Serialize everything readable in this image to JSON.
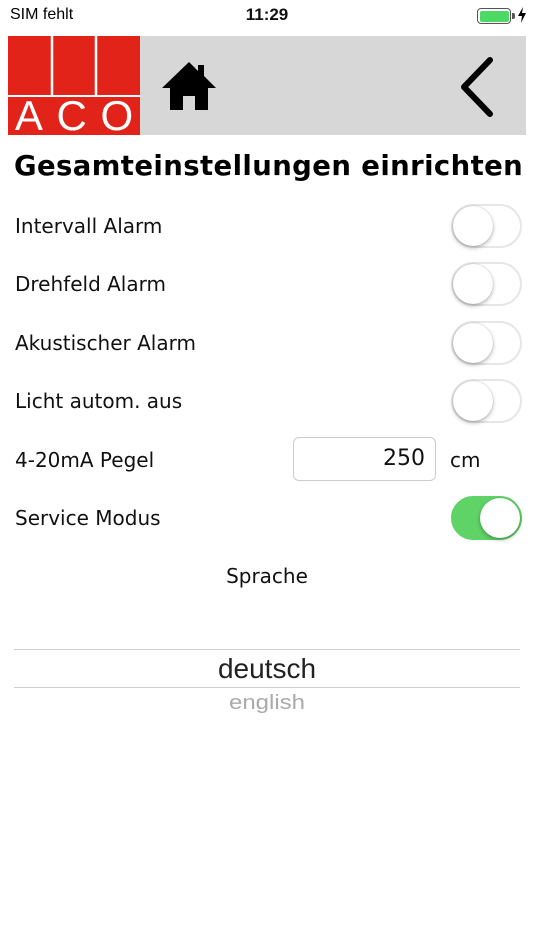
{
  "status_bar": {
    "carrier": "SIM fehlt",
    "time": "11:29",
    "battery_color": "#4cd964"
  },
  "header": {
    "logo_text": [
      "A",
      "C",
      "O"
    ],
    "logo_color": "#e2231a",
    "background": "#d7d7d7",
    "home_icon": "home-icon",
    "back_icon": "chevron-left-icon"
  },
  "title": "Gesamteinstellungen einrichten",
  "settings": {
    "intervall_alarm": {
      "label": "Intervall Alarm",
      "on": false
    },
    "drehfeld_alarm": {
      "label": "Drehfeld Alarm",
      "on": false
    },
    "akustischer_alarm": {
      "label": "Akustischer Alarm",
      "on": false
    },
    "licht_autom_aus": {
      "label": "Licht autom. aus",
      "on": false
    },
    "pegel": {
      "label": "4-20mA Pegel",
      "value": "250",
      "unit": "cm"
    },
    "service_modus": {
      "label": "Service Modus",
      "on": true
    }
  },
  "toggle_on_color": "#5fd366",
  "language": {
    "label": "Sprache",
    "selected": "deutsch",
    "options": [
      "deutsch",
      "english"
    ]
  }
}
